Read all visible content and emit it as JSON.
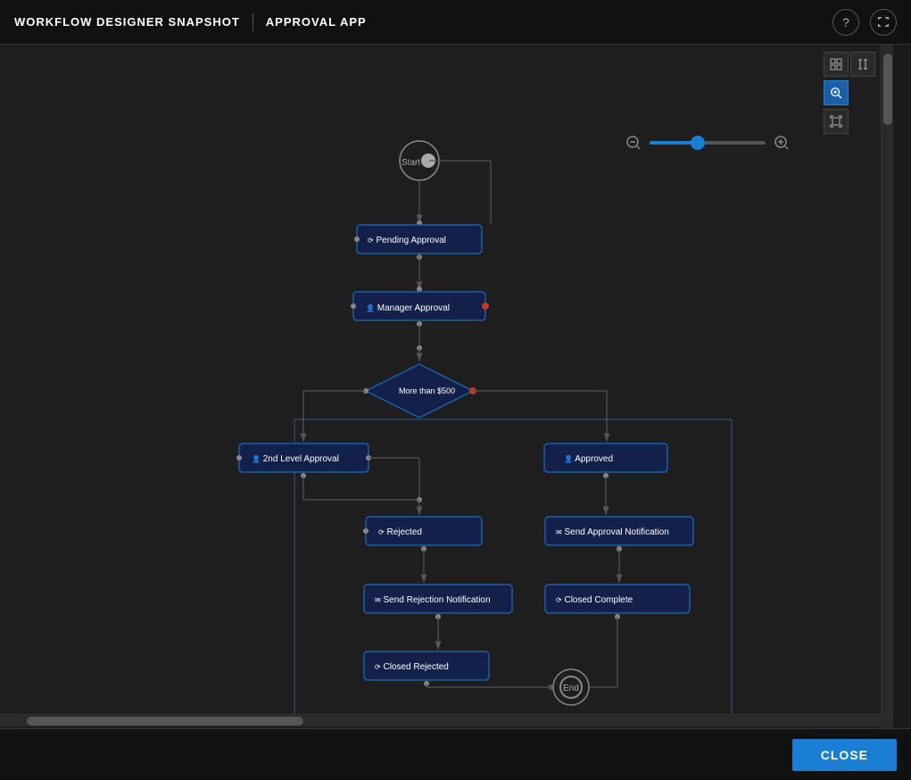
{
  "header": {
    "title": "WORKFLOW DESIGNER SNAPSHOT",
    "subtitle": "APPROVAL APP",
    "help_icon": "?",
    "fullscreen_icon": "⛶"
  },
  "toolbar": {
    "grid_icon": "grid",
    "collapse_icon": "collapse",
    "zoom_icon": "zoom",
    "fit_icon": "fit"
  },
  "zoom": {
    "min_icon": "🔍-",
    "max_icon": "🔍+",
    "value": 40
  },
  "workflow": {
    "nodes": [
      {
        "id": "start",
        "label": "Start",
        "type": "start"
      },
      {
        "id": "pending",
        "label": "Pending Approval",
        "type": "task"
      },
      {
        "id": "manager",
        "label": "Manager Approval",
        "type": "task"
      },
      {
        "id": "diamond",
        "label": "More than $500",
        "type": "diamond"
      },
      {
        "id": "level2",
        "label": "2nd Level Approval",
        "type": "task"
      },
      {
        "id": "approved",
        "label": "Approved",
        "type": "task"
      },
      {
        "id": "rejected",
        "label": "Rejected",
        "type": "task"
      },
      {
        "id": "send_approval",
        "label": "Send Approval Notification",
        "type": "task"
      },
      {
        "id": "send_rejection",
        "label": "Send Rejection Notification",
        "type": "task"
      },
      {
        "id": "closed_complete",
        "label": "Closed Complete",
        "type": "task"
      },
      {
        "id": "closed_rejected",
        "label": "Closed Rejected",
        "type": "task"
      },
      {
        "id": "end",
        "label": "End",
        "type": "end"
      }
    ]
  },
  "footer": {
    "close_label": "CLOSE"
  }
}
